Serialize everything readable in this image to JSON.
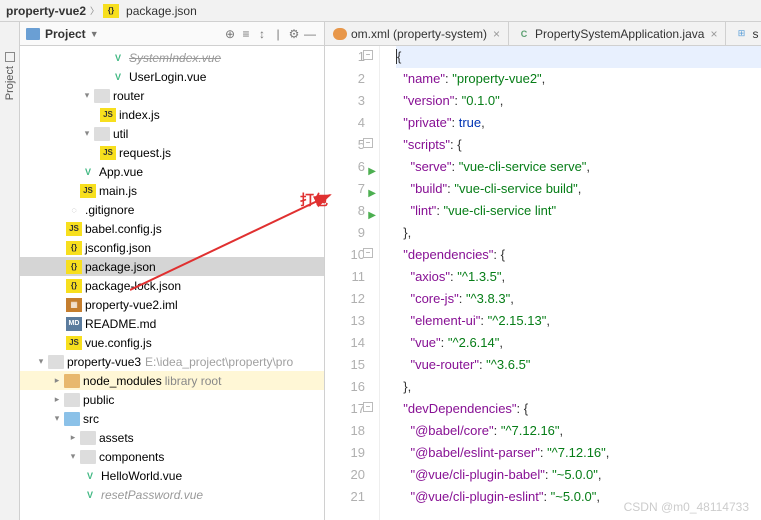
{
  "breadcrumb": {
    "project": "property-vue2",
    "file": "package.json"
  },
  "sidebarHeader": {
    "label": "Project"
  },
  "verticalLabel": "Project",
  "tree": [
    {
      "indent": 90,
      "icon": "vue",
      "label": "SystemIndex.vue",
      "fadedStrike": true
    },
    {
      "indent": 90,
      "icon": "vue",
      "label": "UserLogin.vue"
    },
    {
      "indent": 60,
      "arrow": "down",
      "icon": "folder",
      "label": "router"
    },
    {
      "indent": 80,
      "icon": "js",
      "label": "index.js"
    },
    {
      "indent": 60,
      "arrow": "down",
      "icon": "folder",
      "label": "util"
    },
    {
      "indent": 80,
      "icon": "js",
      "label": "request.js"
    },
    {
      "indent": 60,
      "icon": "vue",
      "label": "App.vue"
    },
    {
      "indent": 60,
      "icon": "js",
      "label": "main.js"
    },
    {
      "indent": 46,
      "icon": "git",
      "label": ".gitignore"
    },
    {
      "indent": 46,
      "icon": "js",
      "label": "babel.config.js"
    },
    {
      "indent": 46,
      "icon": "json",
      "label": "jsconfig.json"
    },
    {
      "indent": 46,
      "icon": "json",
      "label": "package.json",
      "selected": true
    },
    {
      "indent": 46,
      "icon": "json",
      "label": "package-lock.json"
    },
    {
      "indent": 46,
      "icon": "iml",
      "label": "property-vue2.iml"
    },
    {
      "indent": 46,
      "icon": "md",
      "label": "README.md"
    },
    {
      "indent": 46,
      "icon": "js",
      "label": "vue.config.js"
    },
    {
      "indent": 14,
      "arrow": "down",
      "icon": "folder",
      "label": "property-vue3",
      "path": "E:\\idea_project\\property\\pro"
    },
    {
      "indent": 30,
      "arrow": "right",
      "icon": "folder-lib",
      "label": "node_modules",
      "lib": "library root",
      "highlight": true
    },
    {
      "indent": 30,
      "arrow": "right",
      "icon": "folder",
      "label": "public"
    },
    {
      "indent": 30,
      "arrow": "down",
      "icon": "folder-src",
      "label": "src"
    },
    {
      "indent": 46,
      "arrow": "right",
      "icon": "folder",
      "label": "assets"
    },
    {
      "indent": 46,
      "arrow": "down",
      "icon": "folder",
      "label": "components"
    },
    {
      "indent": 62,
      "icon": "vue",
      "label": "HelloWorld.vue"
    },
    {
      "indent": 62,
      "icon": "vue",
      "label": "resetPassword.vue",
      "faded": true
    }
  ],
  "tabs": [
    {
      "icon": "xml",
      "label": "om.xml (property-system)",
      "truncLeft": true
    },
    {
      "icon": "java",
      "label": "PropertySystemApplication.java"
    },
    {
      "icon": "db",
      "label": "s",
      "truncRight": true
    }
  ],
  "code": {
    "lines": [
      {
        "n": 1,
        "fold": "-",
        "tokens": [
          {
            "t": "brace",
            "v": "{"
          }
        ],
        "cursor": true
      },
      {
        "n": 2,
        "tokens": [
          {
            "t": "indent",
            "v": "  "
          },
          {
            "t": "key",
            "v": "\"name\""
          },
          {
            "t": "brace",
            "v": ": "
          },
          {
            "t": "str",
            "v": "\"property-vue2\""
          },
          {
            "t": "brace",
            "v": ","
          }
        ]
      },
      {
        "n": 3,
        "tokens": [
          {
            "t": "indent",
            "v": "  "
          },
          {
            "t": "key",
            "v": "\"version\""
          },
          {
            "t": "brace",
            "v": ": "
          },
          {
            "t": "str",
            "v": "\"0.1.0\""
          },
          {
            "t": "brace",
            "v": ","
          }
        ]
      },
      {
        "n": 4,
        "tokens": [
          {
            "t": "indent",
            "v": "  "
          },
          {
            "t": "key",
            "v": "\"private\""
          },
          {
            "t": "brace",
            "v": ": "
          },
          {
            "t": "bool",
            "v": "true"
          },
          {
            "t": "brace",
            "v": ","
          }
        ]
      },
      {
        "n": 5,
        "fold": "-",
        "tokens": [
          {
            "t": "indent",
            "v": "  "
          },
          {
            "t": "key",
            "v": "\"scripts\""
          },
          {
            "t": "brace",
            "v": ": {"
          }
        ]
      },
      {
        "n": 6,
        "run": true,
        "tokens": [
          {
            "t": "indent",
            "v": "    "
          },
          {
            "t": "key",
            "v": "\"serve\""
          },
          {
            "t": "brace",
            "v": ": "
          },
          {
            "t": "str",
            "v": "\"vue-cli-service serve\""
          },
          {
            "t": "brace",
            "v": ","
          }
        ]
      },
      {
        "n": 7,
        "run": true,
        "tokens": [
          {
            "t": "indent",
            "v": "    "
          },
          {
            "t": "key",
            "v": "\"build\""
          },
          {
            "t": "brace",
            "v": ": "
          },
          {
            "t": "str",
            "v": "\"vue-cli-service build\""
          },
          {
            "t": "brace",
            "v": ","
          }
        ]
      },
      {
        "n": 8,
        "run": true,
        "tokens": [
          {
            "t": "indent",
            "v": "    "
          },
          {
            "t": "key",
            "v": "\"lint\""
          },
          {
            "t": "brace",
            "v": ": "
          },
          {
            "t": "str",
            "v": "\"vue-cli-service lint\""
          }
        ]
      },
      {
        "n": 9,
        "tokens": [
          {
            "t": "indent",
            "v": "  "
          },
          {
            "t": "brace",
            "v": "},"
          }
        ]
      },
      {
        "n": 10,
        "fold": "-",
        "tokens": [
          {
            "t": "indent",
            "v": "  "
          },
          {
            "t": "key",
            "v": "\"dependencies\""
          },
          {
            "t": "brace",
            "v": ": {"
          }
        ]
      },
      {
        "n": 11,
        "tokens": [
          {
            "t": "indent",
            "v": "    "
          },
          {
            "t": "key",
            "v": "\"axios\""
          },
          {
            "t": "brace",
            "v": ": "
          },
          {
            "t": "str",
            "v": "\"^1.3.5\""
          },
          {
            "t": "brace",
            "v": ","
          }
        ]
      },
      {
        "n": 12,
        "tokens": [
          {
            "t": "indent",
            "v": "    "
          },
          {
            "t": "key",
            "v": "\"core-js\""
          },
          {
            "t": "brace",
            "v": ": "
          },
          {
            "t": "str",
            "v": "\"^3.8.3\""
          },
          {
            "t": "brace",
            "v": ","
          }
        ]
      },
      {
        "n": 13,
        "tokens": [
          {
            "t": "indent",
            "v": "    "
          },
          {
            "t": "key",
            "v": "\"element-ui\""
          },
          {
            "t": "brace",
            "v": ": "
          },
          {
            "t": "str",
            "v": "\"^2.15.13\""
          },
          {
            "t": "brace",
            "v": ","
          }
        ]
      },
      {
        "n": 14,
        "tokens": [
          {
            "t": "indent",
            "v": "    "
          },
          {
            "t": "key",
            "v": "\"vue\""
          },
          {
            "t": "brace",
            "v": ": "
          },
          {
            "t": "str",
            "v": "\"^2.6.14\""
          },
          {
            "t": "brace",
            "v": ","
          }
        ]
      },
      {
        "n": 15,
        "tokens": [
          {
            "t": "indent",
            "v": "    "
          },
          {
            "t": "key",
            "v": "\"vue-router\""
          },
          {
            "t": "brace",
            "v": ": "
          },
          {
            "t": "str",
            "v": "\"^3.6.5\""
          }
        ]
      },
      {
        "n": 16,
        "tokens": [
          {
            "t": "indent",
            "v": "  "
          },
          {
            "t": "brace",
            "v": "},"
          }
        ]
      },
      {
        "n": 17,
        "fold": "-",
        "tokens": [
          {
            "t": "indent",
            "v": "  "
          },
          {
            "t": "key",
            "v": "\"devDependencies\""
          },
          {
            "t": "brace",
            "v": ": {"
          }
        ]
      },
      {
        "n": 18,
        "tokens": [
          {
            "t": "indent",
            "v": "    "
          },
          {
            "t": "key",
            "v": "\"@babel/core\""
          },
          {
            "t": "brace",
            "v": ": "
          },
          {
            "t": "str",
            "v": "\"^7.12.16\""
          },
          {
            "t": "brace",
            "v": ","
          }
        ]
      },
      {
        "n": 19,
        "tokens": [
          {
            "t": "indent",
            "v": "    "
          },
          {
            "t": "key",
            "v": "\"@babel/eslint-parser\""
          },
          {
            "t": "brace",
            "v": ": "
          },
          {
            "t": "str",
            "v": "\"^7.12.16\""
          },
          {
            "t": "brace",
            "v": ","
          }
        ]
      },
      {
        "n": 20,
        "tokens": [
          {
            "t": "indent",
            "v": "    "
          },
          {
            "t": "key",
            "v": "\"@vue/cli-plugin-babel\""
          },
          {
            "t": "brace",
            "v": ": "
          },
          {
            "t": "str",
            "v": "\"~5.0.0\""
          },
          {
            "t": "brace",
            "v": ","
          }
        ]
      },
      {
        "n": 21,
        "tokens": [
          {
            "t": "indent",
            "v": "    "
          },
          {
            "t": "key",
            "v": "\"@vue/cli-plugin-eslint\""
          },
          {
            "t": "brace",
            "v": ": "
          },
          {
            "t": "str",
            "v": "\"~5.0.0\""
          },
          {
            "t": "brace",
            "v": ","
          }
        ]
      }
    ]
  },
  "annotation": {
    "text": "打包"
  },
  "watermark": "CSDN @m0_48114733"
}
